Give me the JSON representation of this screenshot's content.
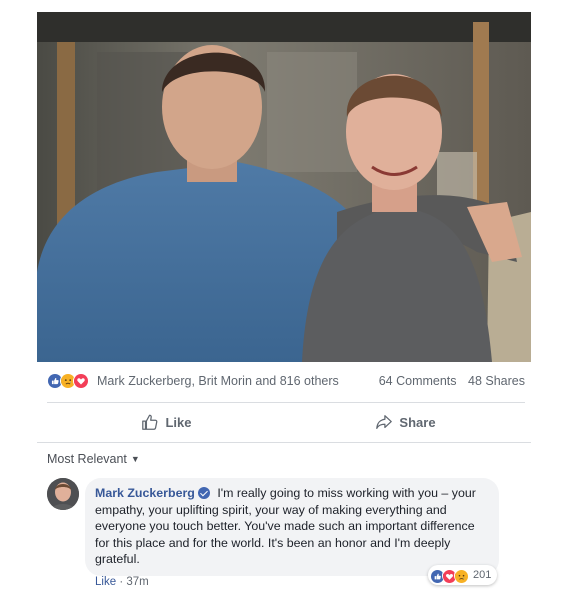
{
  "post": {
    "reactions": {
      "icons": [
        "like-icon",
        "sad-icon",
        "love-icon"
      ],
      "summary": "Mark Zuckerberg, Brit Morin and 816 others",
      "comments": "64 Comments",
      "shares": "48 Shares"
    },
    "actions": {
      "like_label": "Like",
      "share_label": "Share"
    }
  },
  "comments": {
    "sort_label": "Most Relevant",
    "items": [
      {
        "author": "Mark Zuckerberg",
        "text": "I'm really going to miss working with you – your empathy, your uplifting spirit, your way of making everything and everyone you touch better. You've made such an important difference for this place and for the world. It's been an honor and I'm deeply grateful.",
        "like_label": "Like",
        "time": "37m",
        "reaction_count": "201",
        "reaction_icons": [
          "like-icon",
          "love-icon",
          "sad-icon"
        ]
      }
    ]
  },
  "colors": {
    "link": "#385898",
    "like_blue": "#4267b2",
    "love_red": "#f33e58",
    "sad_yellow": "#f7b125",
    "secondary_text": "#606770"
  }
}
